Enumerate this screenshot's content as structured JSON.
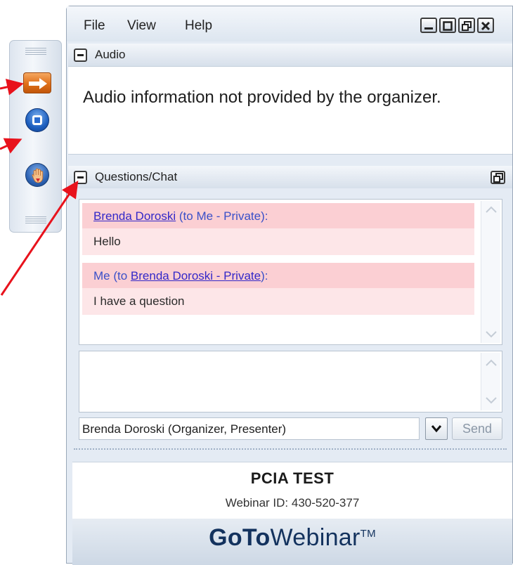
{
  "menu": {
    "file": "File",
    "view": "View",
    "help": "Help"
  },
  "audio": {
    "title": "Audio",
    "message": "Audio information not provided by the organizer."
  },
  "chat": {
    "title": "Questions/Chat",
    "messages": [
      {
        "sender": "Brenda Doroski",
        "meta": " (to Me - Private):",
        "text": "Hello"
      },
      {
        "prefix": "Me (to ",
        "recipient": "Brenda Doroski - Private",
        "suffix": "):",
        "text": "I have a question"
      }
    ],
    "input_value": "",
    "recipient": "Brenda Doroski (Organizer, Presenter)",
    "send_label": "Send"
  },
  "footer": {
    "session_title": "PCIA TEST",
    "webinar_id": "Webinar ID: 430-520-377",
    "logo_bold": "GoTo",
    "logo_rest": "Webinar",
    "logo_tm": "TM"
  },
  "colors": {
    "annotation_arrow": "#e8121c",
    "accent_orange": "#de6f1a",
    "accent_blue": "#1d5fbf",
    "message_header": "#fbcfd3",
    "message_body": "#fde6e8",
    "logo": "#13325e"
  },
  "icons": [
    "arrow-right-icon",
    "screen-share-icon",
    "raise-hand-icon",
    "minimize-icon",
    "maximize-icon",
    "restore-icon",
    "close-icon",
    "collapse-icon",
    "popout-icon",
    "chevron-down-icon",
    "scroll-up-icon",
    "scroll-down-icon"
  ]
}
